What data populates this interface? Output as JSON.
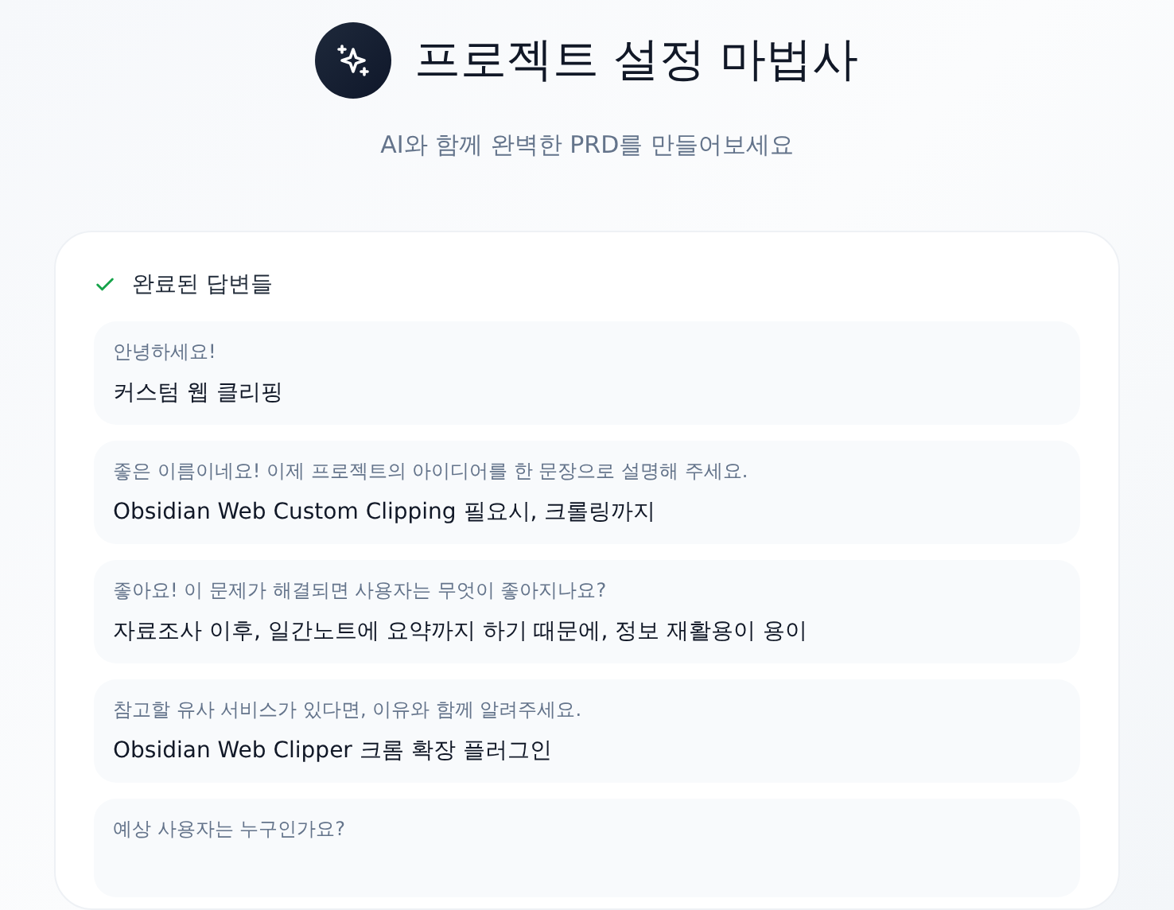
{
  "header": {
    "title": "프로젝트 설정 마법사",
    "subtitle": "AI와 함께 완벽한 PRD를 만들어보세요"
  },
  "answers_panel": {
    "title": "완료된 답변들",
    "items": [
      {
        "question": "안녕하세요!",
        "answer": "커스텀 웹 클리핑"
      },
      {
        "question": "좋은 이름이네요! 이제 프로젝트의 아이디어를 한 문장으로 설명해 주세요.",
        "answer": "Obsidian Web Custom Clipping 필요시, 크롤링까지"
      },
      {
        "question": "좋아요! 이 문제가 해결되면 사용자는 무엇이 좋아지나요?",
        "answer": "자료조사 이후, 일간노트에 요약까지 하기 때문에, 정보 재활용이 용이"
      },
      {
        "question": "참고할 유사 서비스가 있다면, 이유와 함께 알려주세요.",
        "answer": "Obsidian Web Clipper 크롬 확장 플러그인"
      },
      {
        "question": "예상 사용자는 누구인가요?"
      }
    ]
  }
}
